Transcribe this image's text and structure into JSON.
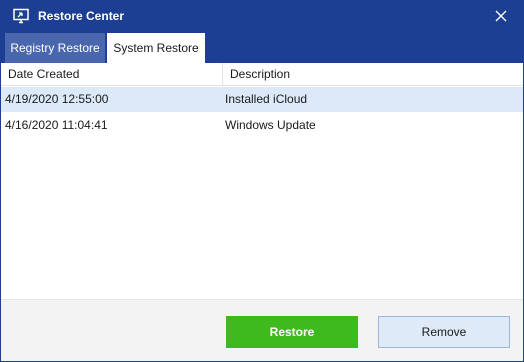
{
  "window": {
    "title": "Restore Center",
    "icons": {
      "app": "monitor-restore-icon",
      "close": "close-icon"
    },
    "colors": {
      "titlebar": "#1c3f94",
      "tab_inactive": "#4a67ad",
      "selected_row": "#dce9f8",
      "restore_button": "#3fba1e",
      "remove_button": "#dfeaf8"
    }
  },
  "tabs": [
    {
      "label": "Registry Restore",
      "active": false
    },
    {
      "label": "System Restore",
      "active": true
    }
  ],
  "list": {
    "columns": [
      "Date Created",
      "Description"
    ],
    "rows": [
      {
        "date": "4/19/2020 12:55:00",
        "description": "Installed iCloud",
        "selected": true
      },
      {
        "date": "4/16/2020 11:04:41",
        "description": "Windows Update",
        "selected": false
      }
    ]
  },
  "buttons": {
    "restore": "Restore",
    "remove": "Remove"
  }
}
